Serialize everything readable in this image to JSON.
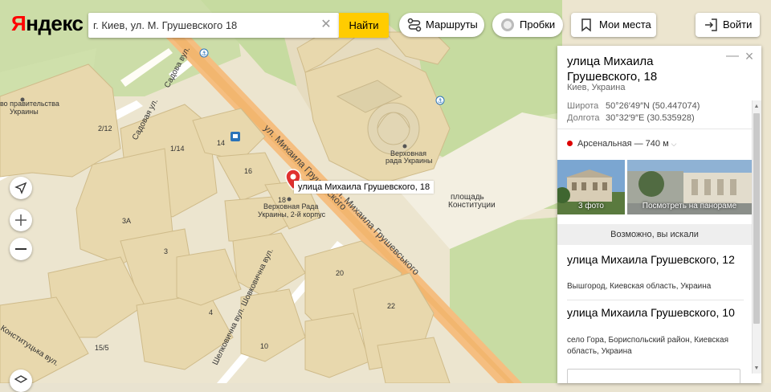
{
  "header": {
    "logo": "Яндекс",
    "search": {
      "value": "г. Киев, ул. М. Грушевского 18"
    },
    "find_label": "Найти",
    "routes_label": "Маршруты",
    "traffic_label": "Пробки",
    "places_label": "Мои места",
    "login_label": "Войти"
  },
  "map": {
    "pin_label": "улица Михаила Грушевского, 18",
    "labels": {
      "street_main_1": "ул. Михаила Грушевского",
      "street_main_2": "вул. Михаила Грушевського",
      "sadovaya": "Садовая ул.",
      "sadova": "Садова вул.",
      "shovkovichna": "Шелковична вул. Шовковична вул.",
      "konstitutska": "Конституцька вул.",
      "square_1": "площадь",
      "square_2": "Конституции",
      "rada_1": "Верховная",
      "rada_2": "рада Украины",
      "rada2_1": "Верховная Рада",
      "rada2_2": "Украины, 2-й корпус",
      "gov_1": "во правительства",
      "gov_2": "Украины",
      "h18": "18",
      "h14": "14",
      "h16": "16",
      "h2_12": "2/12",
      "h1_14": "1/14",
      "h3a": "3А",
      "h3": "3",
      "h4": "4",
      "h10": "10",
      "h20": "20",
      "h22": "22",
      "h15_5": "15/5"
    }
  },
  "panel": {
    "title": "улица Михаила Грушевского, 18",
    "subtitle": "Киев, Украина",
    "lat_label": "Широта",
    "lat_value": "50°26′49″N (50.447074)",
    "lon_label": "Долгота",
    "lon_value": "30°32′9″E (30.535928)",
    "metro": "Арсенальная — 740 м",
    "metro_color": "#d00000",
    "photos_caption": "3 фото",
    "panorama_caption": "Посмотреть на панораме",
    "maybe_heading": "Возможно, вы искали",
    "results": [
      {
        "title": "улица Михаила Грушевского, 12",
        "subtitle": "Вышгород, Киевская область, Украина"
      },
      {
        "title": "улица Михаила Грушевского, 10",
        "subtitle": "село Гора, Бориспольский район, Киевская область, Украина"
      }
    ]
  },
  "colors": {
    "search_button": "#ffcc00",
    "main_road": "#f5be80",
    "building": "#e8d8ad"
  }
}
